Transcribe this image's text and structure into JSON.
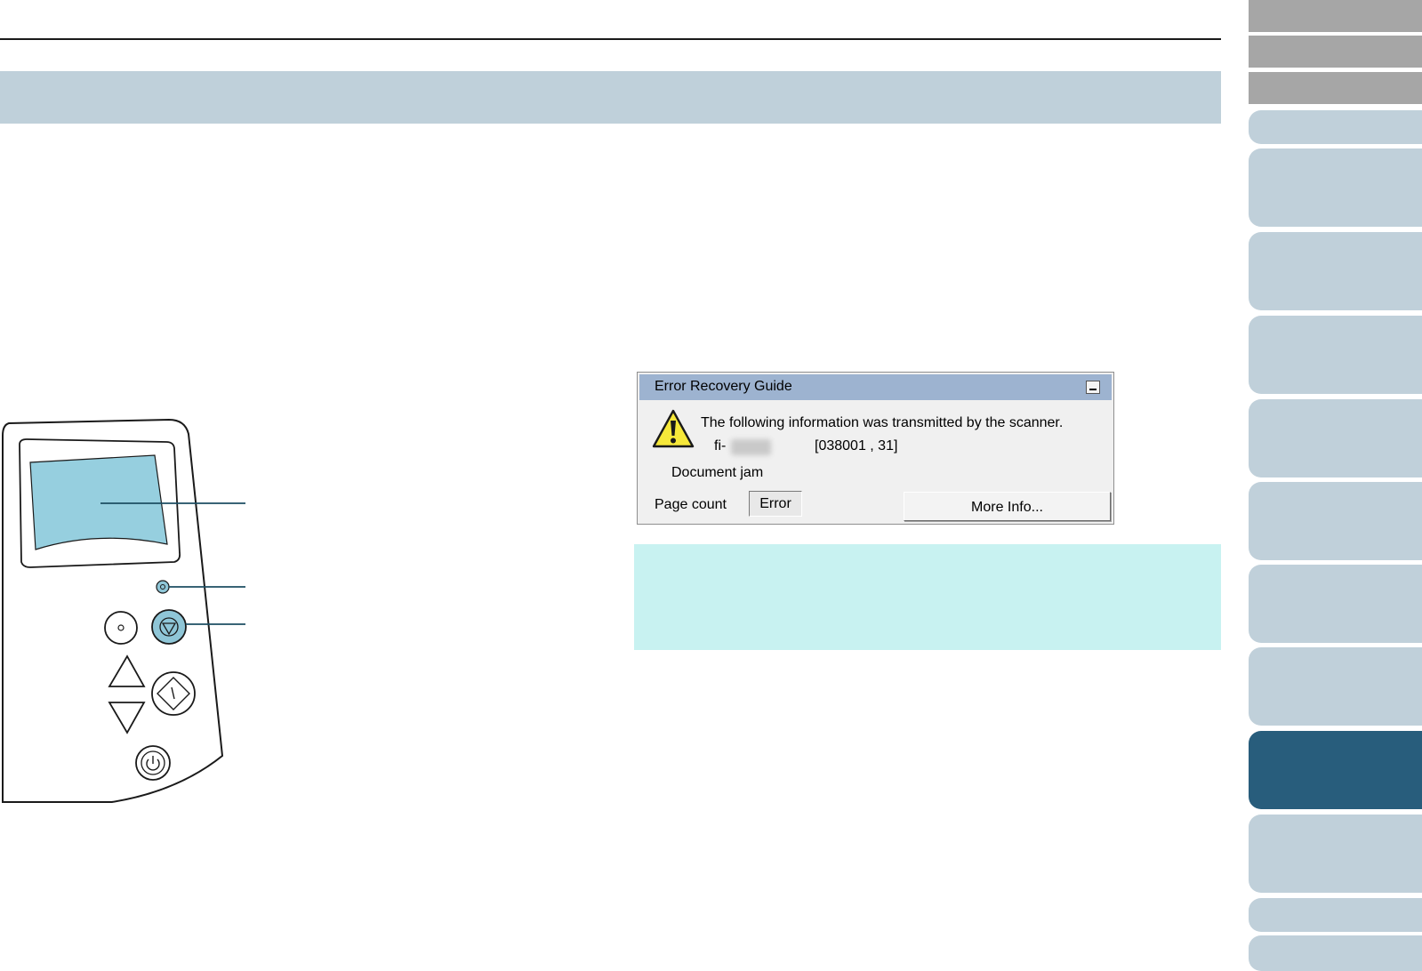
{
  "colors": {
    "heading_band": "#bfd0da",
    "side_tab_light": "#c0d0da",
    "side_tab_gray": "#a6a6a6",
    "side_tab_active": "#285d7c",
    "lcd_screen": "#96cfdf",
    "hint_box": "#c8f2f1",
    "dialog_titlebar": "#9db3d0"
  },
  "dialog": {
    "title": "Error Recovery Guide",
    "message": "The following information was transmitted by the scanner.",
    "model_prefix": "fi-",
    "code": "[038001 , 31]",
    "status": "Document jam",
    "page_count_label": "Page count",
    "page_count_value": "Error",
    "more_info_label": "More Info...",
    "warning_icon": "warning-icon",
    "minimize_icon": "minimize-icon"
  },
  "panel": {
    "icons": [
      "menu-button-icon",
      "stop-button-icon",
      "up-arrow-icon",
      "down-arrow-icon",
      "start-button-icon",
      "power-button-icon",
      "indicator-lamp-icon"
    ]
  },
  "side_nav": {
    "active_index": 8,
    "tab_count": 13
  }
}
